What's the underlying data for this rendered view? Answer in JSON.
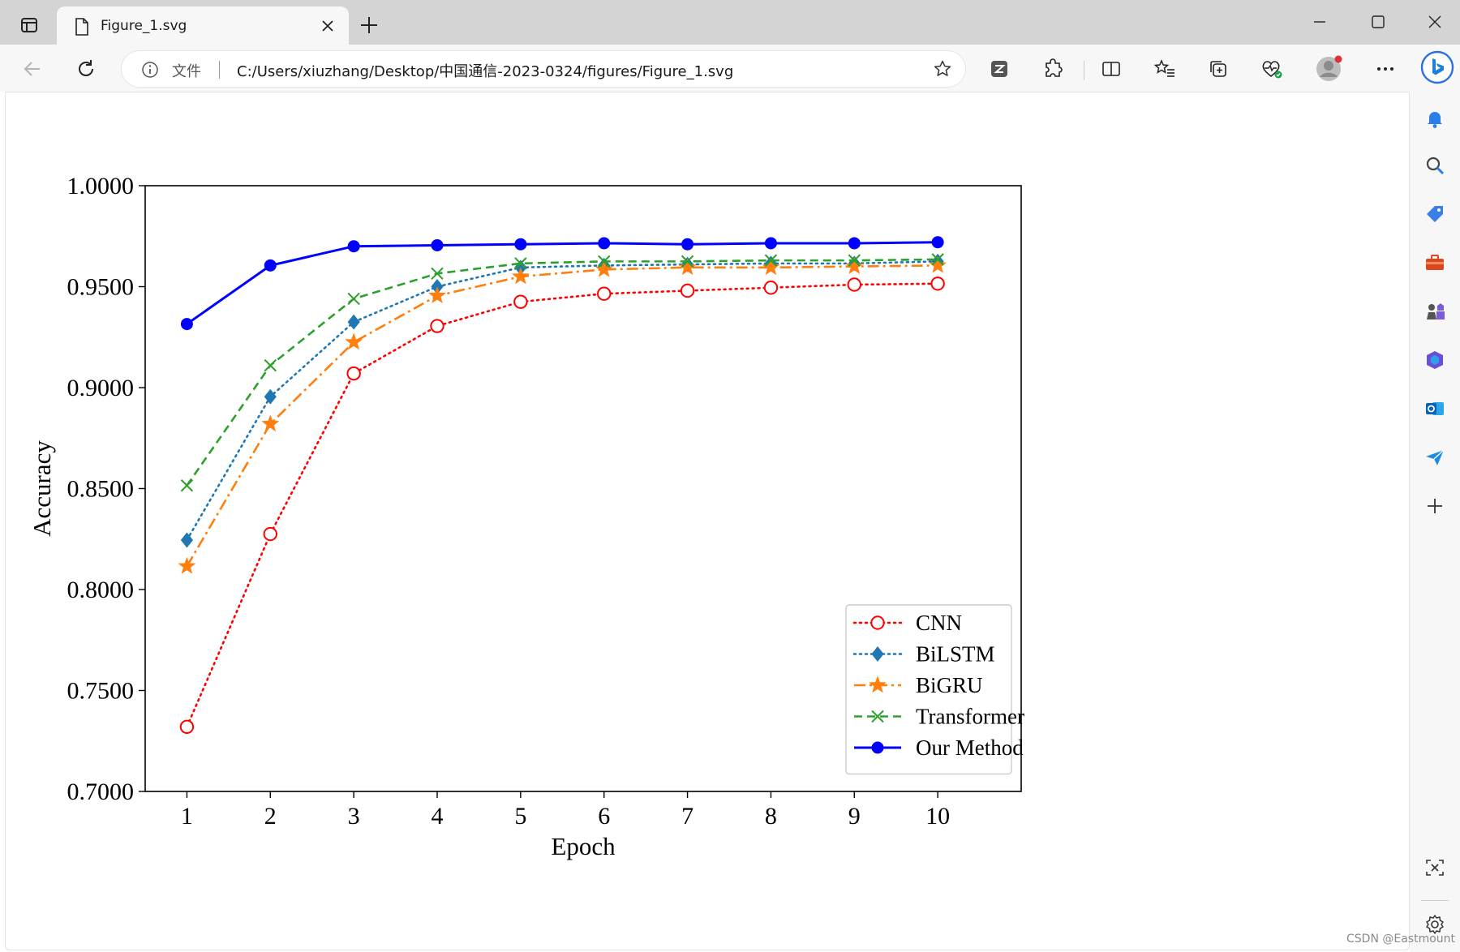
{
  "browser": {
    "tab_title": "Figure_1.svg",
    "address_label": "文件",
    "address_url": "C:/Users/xiuzhang/Desktop/中国通信-2023-0324/figures/Figure_1.svg",
    "icons": [
      "tab-actions-icon",
      "document-icon",
      "close-icon",
      "plus-icon",
      "minimize-icon",
      "maximize-icon",
      "window-close-icon",
      "back-icon",
      "refresh-icon",
      "info-icon",
      "star-icon",
      "reader-icon",
      "extensions-icon",
      "split-screen-icon",
      "favorites-icon",
      "collections-icon",
      "health-icon",
      "profile-icon",
      "more-icon",
      "bing-icon"
    ],
    "sidebar_icons": [
      "bell-icon",
      "search-icon",
      "tag-icon",
      "briefcase-icon",
      "chess-icon",
      "office-icon",
      "outlook-icon",
      "send-icon",
      "plus-icon",
      "screenshot-icon",
      "settings-icon"
    ],
    "watermark": "CSDN @Eastmount"
  },
  "chart_data": {
    "type": "line",
    "title": "",
    "xlabel": "Epoch",
    "ylabel": "Accuracy",
    "x": [
      1,
      2,
      3,
      4,
      5,
      6,
      7,
      8,
      9,
      10
    ],
    "xticks": [
      "1",
      "2",
      "3",
      "4",
      "5",
      "6",
      "7",
      "8",
      "9",
      "10"
    ],
    "yticks": [
      "0.7000",
      "0.7500",
      "0.8000",
      "0.8500",
      "0.9000",
      "0.9500",
      "1.0000"
    ],
    "xlim": [
      0.5,
      11
    ],
    "ylim": [
      0.7,
      1.0
    ],
    "legend_position": "lower right",
    "grid": false,
    "series": [
      {
        "name": "CNN",
        "color": "#ff0000",
        "marker": "open-circle",
        "style": "dotted",
        "values": [
          0.732,
          0.8275,
          0.907,
          0.9305,
          0.9425,
          0.9465,
          0.948,
          0.9495,
          0.951,
          0.9515
        ]
      },
      {
        "name": "BiLSTM",
        "color": "#1f77b4",
        "marker": "diamond",
        "style": "dotted",
        "values": [
          0.8245,
          0.8955,
          0.9325,
          0.95,
          0.9595,
          0.9605,
          0.961,
          0.9615,
          0.9615,
          0.9625
        ]
      },
      {
        "name": "BiGRU",
        "color": "#ff7f0e",
        "marker": "star",
        "style": "dashdot",
        "values": [
          0.8115,
          0.882,
          0.9225,
          0.9455,
          0.955,
          0.9585,
          0.9595,
          0.9595,
          0.96,
          0.9605
        ]
      },
      {
        "name": "Transformer",
        "color": "#2ca02c",
        "marker": "x",
        "style": "dashed",
        "values": [
          0.8515,
          0.911,
          0.944,
          0.9565,
          0.9615,
          0.9625,
          0.9625,
          0.963,
          0.963,
          0.9635
        ]
      },
      {
        "name": "Our Method",
        "color": "#0000ff",
        "marker": "filled-circle",
        "style": "solid",
        "values": [
          0.9315,
          0.9605,
          0.97,
          0.9705,
          0.971,
          0.9715,
          0.971,
          0.9715,
          0.9715,
          0.972
        ]
      }
    ]
  }
}
